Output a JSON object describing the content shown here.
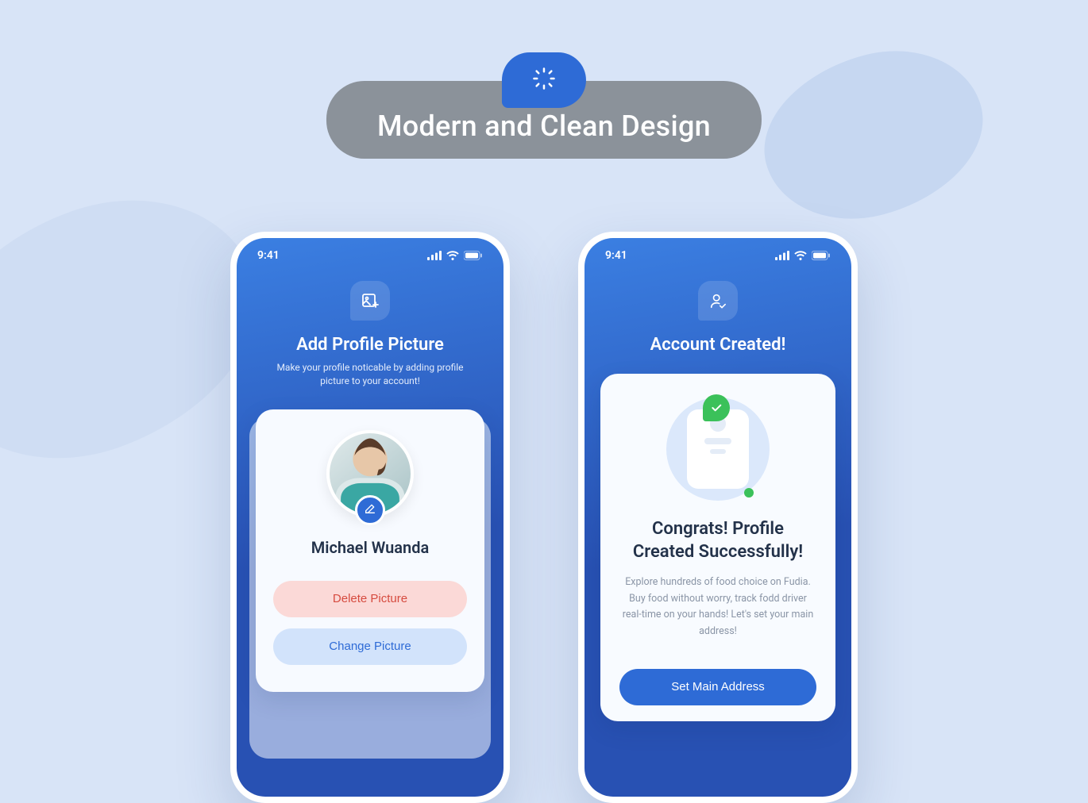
{
  "banner": {
    "title": "Modern and Clean Design"
  },
  "status": {
    "time": "9:41"
  },
  "screens": {
    "profile": {
      "title": "Add Profile Picture",
      "subtitle": "Make your profile noticable by adding profile picture to your account!",
      "user_name": "Michael Wuanda",
      "delete_label": "Delete Picture",
      "change_label": "Change Picture"
    },
    "created": {
      "title": "Account Created!",
      "congrats_title": "Congrats! Profile Created Successfully!",
      "congrats_sub": "Explore hundreds of food choice on Fudia. Buy food without worry, track fodd driver real-time on your hands! Let's set your main address!",
      "cta_label": "Set Main Address"
    }
  }
}
